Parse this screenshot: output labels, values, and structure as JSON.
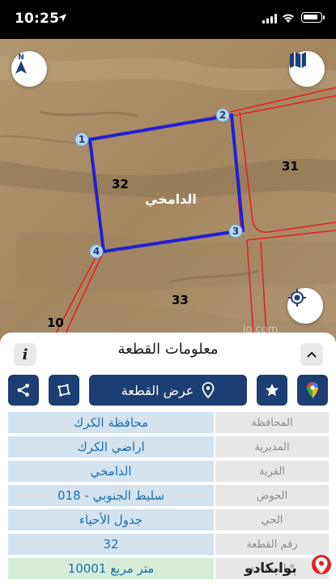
{
  "status_bar": {
    "time": "10:25"
  },
  "map": {
    "parcel_labels": {
      "main_number": "32",
      "main_name": "الدامخي",
      "north_east": "31",
      "south": "33",
      "south_west": "10"
    },
    "vertex_labels": [
      "1",
      "2",
      "3",
      "4"
    ],
    "watermark": "jo.com",
    "colors": {
      "parcel_outline": "#1f1fd6",
      "neighbor_lines": "#e32222"
    }
  },
  "panel": {
    "title": "معلومات القطعة",
    "view_button_label": "عرض القطعة",
    "icons": [
      "share-icon",
      "crop-icon",
      "location-pin-icon",
      "star-icon",
      "google-maps-icon",
      "info-icon",
      "chevron-up-icon"
    ],
    "rows": [
      {
        "label": "المحافظة",
        "value": "محافظة الكرك"
      },
      {
        "label": "المديرية",
        "value": "اراضي الكرك"
      },
      {
        "label": "القرية",
        "value": "الدامخي"
      },
      {
        "label": "الحوض",
        "value": "سليط الجنوبي - 018"
      },
      {
        "label": "الحي",
        "value": "جدول الأحياء"
      },
      {
        "label": "رقم القطعة",
        "value": "32"
      },
      {
        "label": "المساحة *",
        "value": "10001  متر مربع"
      }
    ]
  },
  "brand": {
    "logo_text": "بوابكادو"
  }
}
